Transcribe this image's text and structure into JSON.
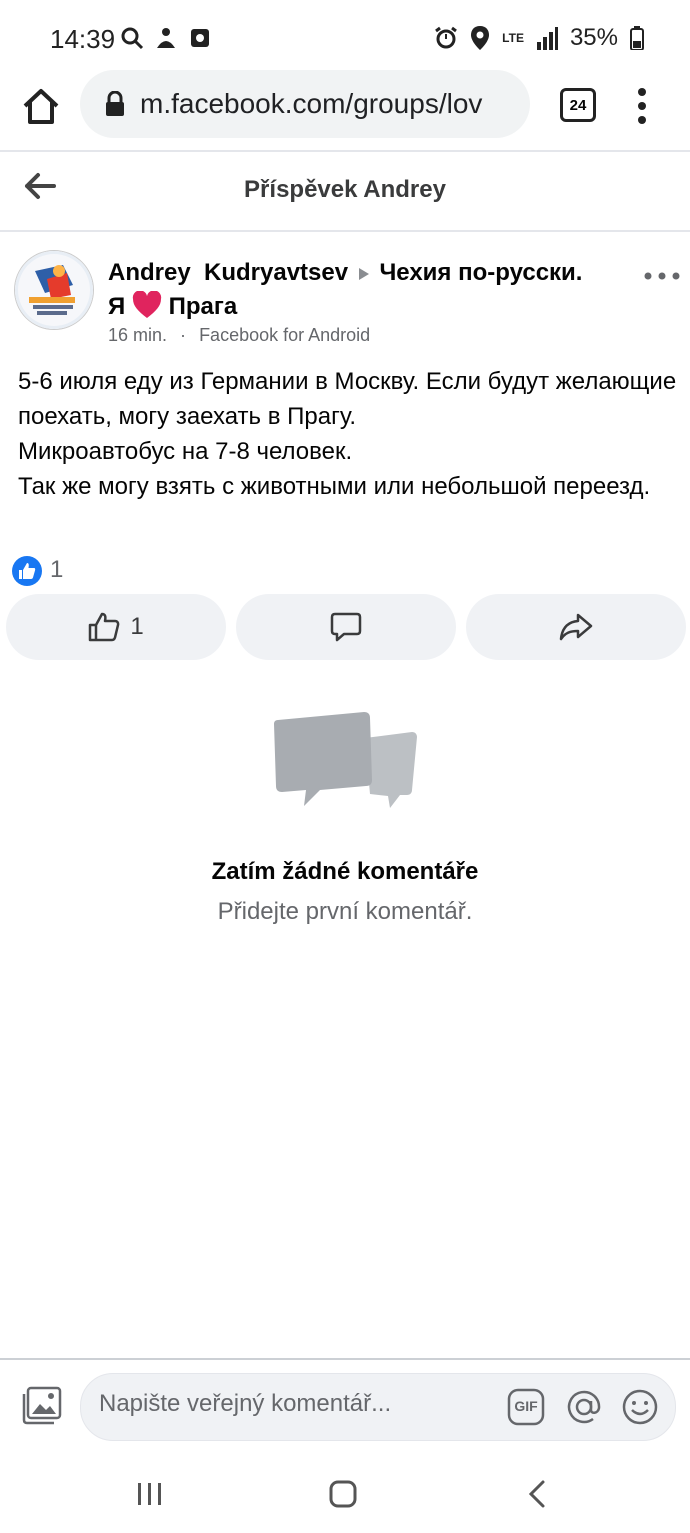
{
  "status_bar": {
    "time": "14:39",
    "battery": "35%",
    "network": "LTE",
    "left_icons": [
      "search-icon",
      "bixby-icon",
      "screen-record-icon"
    ],
    "right_icons": [
      "alarm-icon",
      "location-icon",
      "signal-icon",
      "battery-icon"
    ]
  },
  "browser": {
    "url": "m.facebook.com/groups/lov",
    "tab_count": "24"
  },
  "header": {
    "title": "Příspěvek Andrey"
  },
  "post": {
    "author": "Andrey  Kudryavtsev",
    "group_prefix": "Чехия по-русски.",
    "group_suffix_1": "Я",
    "group_suffix_2": "Прага",
    "time": "16 min.",
    "separator": "·",
    "source": "Facebook for Android",
    "body": "5-6 июля еду из Германии в Москву. Если будут желающие поехать, могу заехать в Прагу.\nМикроавтобус на 7-8 человек.\nТак же могу взять с животными или небольшой переезд.",
    "reaction_count": "1",
    "like_count": "1"
  },
  "empty_state": {
    "title": "Zatím žádné komentáře",
    "subtitle": "Přidejte první komentář."
  },
  "composer": {
    "placeholder": "Napište veřejný komentář...",
    "gif_label": "GIF"
  },
  "colors": {
    "facebook_blue": "#1877f2",
    "heart_red": "#e0245e",
    "button_gray": "#f0f2f5",
    "secondary_text": "#65676b"
  }
}
